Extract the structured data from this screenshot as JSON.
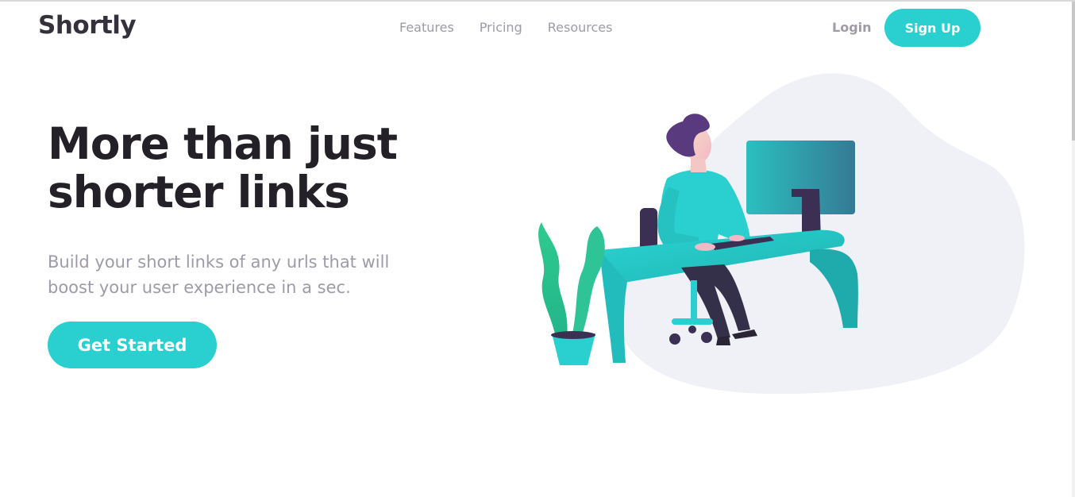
{
  "brand": {
    "logo": "Shortly"
  },
  "nav": {
    "links": [
      {
        "label": "Features"
      },
      {
        "label": "Pricing"
      },
      {
        "label": "Resources"
      }
    ],
    "login_label": "Login",
    "signup_label": "Sign Up"
  },
  "hero": {
    "title_line1": "More than just",
    "title_line2": "shorter links",
    "subtitle": "Build your short links of any urls that will boost your user experience in a sec.",
    "cta_label": "Get Started"
  },
  "colors": {
    "primary_cyan": "#2acfcf",
    "dark_violet": "#3b3054",
    "text_gray": "#9e9aa8",
    "heading_dark": "#232127",
    "blob_gray": "#eff1f7"
  },
  "illustration": {
    "name": "person-working-at-desk",
    "elements": [
      "person",
      "desk",
      "monitor",
      "chair",
      "plant",
      "keyboard"
    ]
  }
}
